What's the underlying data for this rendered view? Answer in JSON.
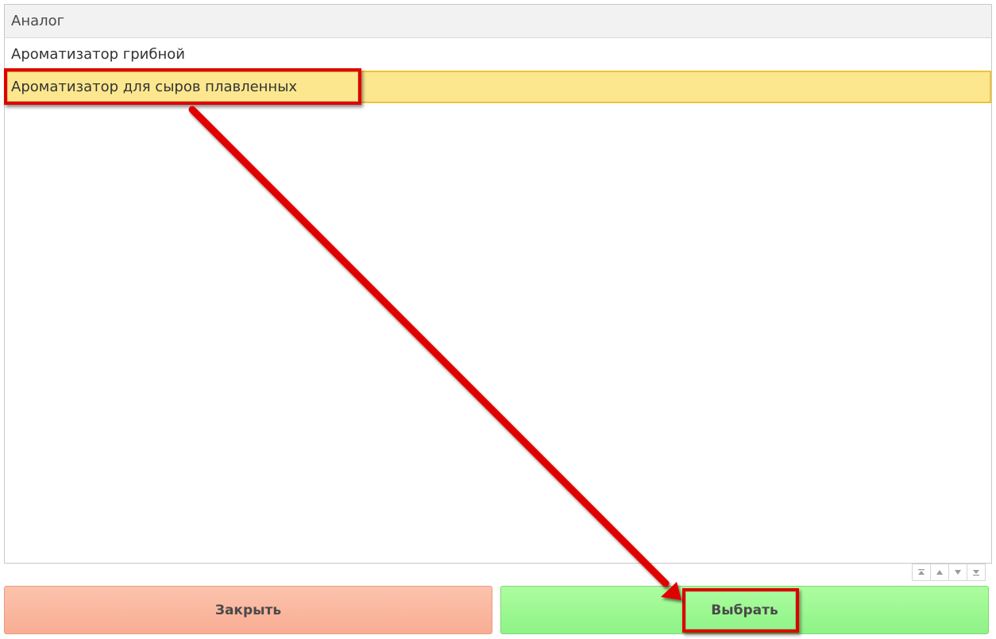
{
  "grid": {
    "header": "Аналог",
    "rows": [
      {
        "label": "Ароматизатор грибной",
        "selected": false
      },
      {
        "label": "Ароматизатор для сыров плавленных",
        "selected": true
      }
    ]
  },
  "pager": {
    "first_glyph": "⏫",
    "prev_glyph": "▲",
    "next_glyph": "▼",
    "last_glyph": "⏬"
  },
  "buttons": {
    "close_label": "Закрыть",
    "select_label": "Выбрать"
  },
  "colors": {
    "selected_row": "#fce78f",
    "close_button": "#f8ad93",
    "select_button": "#8ef386",
    "annotation": "#e00000"
  }
}
